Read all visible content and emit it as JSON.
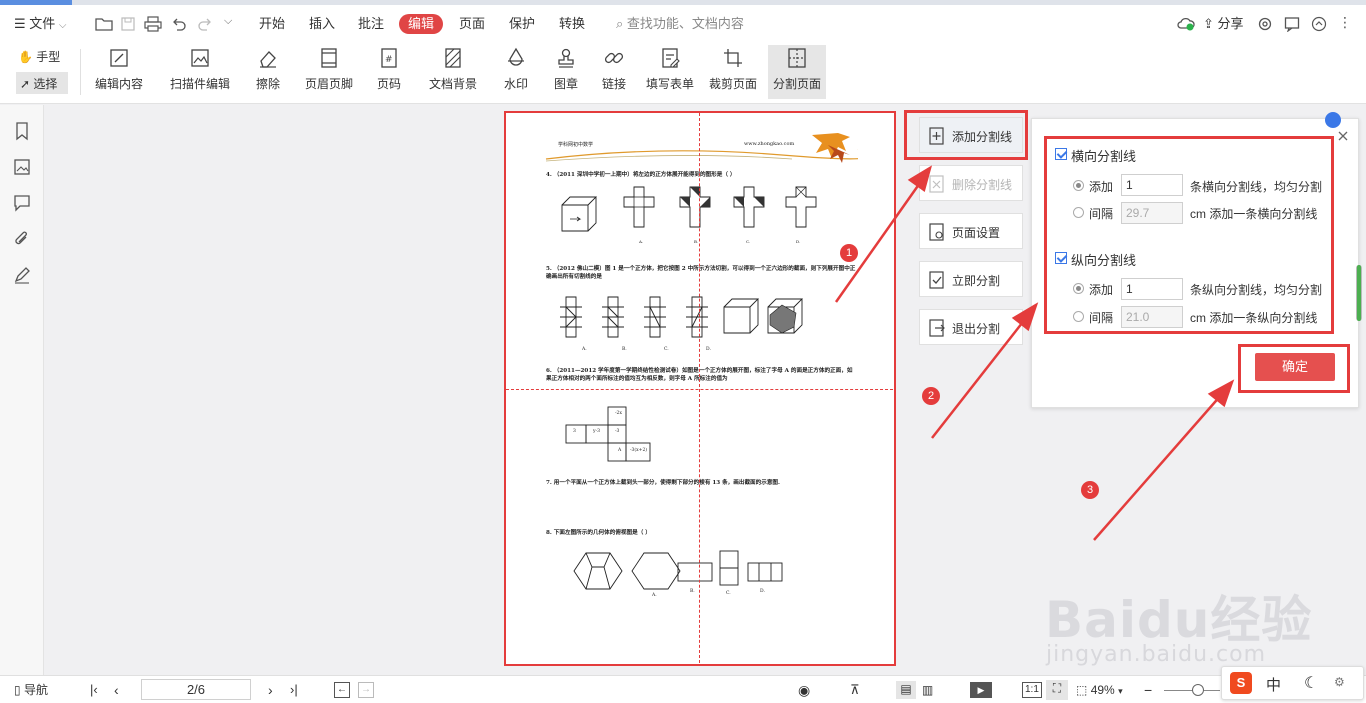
{
  "menubar": {
    "file": "文件",
    "tabs": [
      "开始",
      "插入",
      "批注",
      "编辑",
      "页面",
      "保护",
      "转换"
    ],
    "active_tab": "编辑",
    "search_placeholder": "查找功能、文档内容",
    "share": "分享"
  },
  "ribbon": {
    "hand": "手型",
    "select": "选择",
    "tools": [
      "编辑内容",
      "扫描件编辑",
      "擦除",
      "页眉页脚",
      "页码",
      "文档背景",
      "水印",
      "图章",
      "链接",
      "填写表单",
      "裁剪页面",
      "分割页面"
    ],
    "active_tool": "分割页面"
  },
  "split_actions": {
    "add_line": "添加分割线",
    "delete_line": "删除分割线",
    "page_setup": "页面设置",
    "split_now": "立即分割",
    "exit_split": "退出分割"
  },
  "split_panel": {
    "horizontal": {
      "title": "横向分割线",
      "add_label": "添加",
      "add_value": "1",
      "add_suffix": "条横向分割线，均匀分割",
      "interval_label": "间隔",
      "interval_value": "29.7",
      "interval_suffix": "cm 添加一条横向分割线"
    },
    "vertical": {
      "title": "纵向分割线",
      "add_label": "添加",
      "add_value": "1",
      "add_suffix": "条纵向分割线，均匀分割",
      "interval_label": "间隔",
      "interval_value": "21.0",
      "interval_suffix": "cm 添加一条纵向分割线"
    },
    "confirm": "确定"
  },
  "badges": [
    "1",
    "2",
    "3"
  ],
  "document": {
    "header_left": "学科网初中数学",
    "header_url": "www.zhongkao.com",
    "q4": "4.    （2011 深圳中学初一上期中）将左边的正方体展开能得到的图形是（     ）",
    "q5": "5.    （2012 佛山二模）图 1 是一个正方体，把它按图 2 中所示方法切割，可以得到一个正六边形的截面，则下列展开图中正确画出所有切割线的是",
    "q6": "6.    （2011—2012 学年度第一学期终结性检测试卷）如图是一个正方体的展开图，标注了字母 A 的面是正方体的正面，如果正方体相对的两个面所标注的值均互为相反数，则字母 A 所标注的值为",
    "q7": "7.    用一个平面从一个正方体上截到头一部分，使得剩下部分的棱有 13 条，画出截面的示意图.",
    "q8": "8.    下面左图所示的几何体的俯视图是（     ）",
    "opts_a": "A.",
    "opts_b": "B.",
    "opts_c": "C.",
    "opts_d": "D.",
    "net_cells": [
      "-2x",
      "3",
      "y-3",
      "-3",
      "A",
      "-3(x+2)"
    ]
  },
  "statusbar": {
    "nav": "导航",
    "page": "2/6",
    "zoom": "49%"
  },
  "ime": {
    "lang": "中"
  },
  "watermark": {
    "text": "Baidu经验",
    "url": "jingyan.baidu.com"
  }
}
